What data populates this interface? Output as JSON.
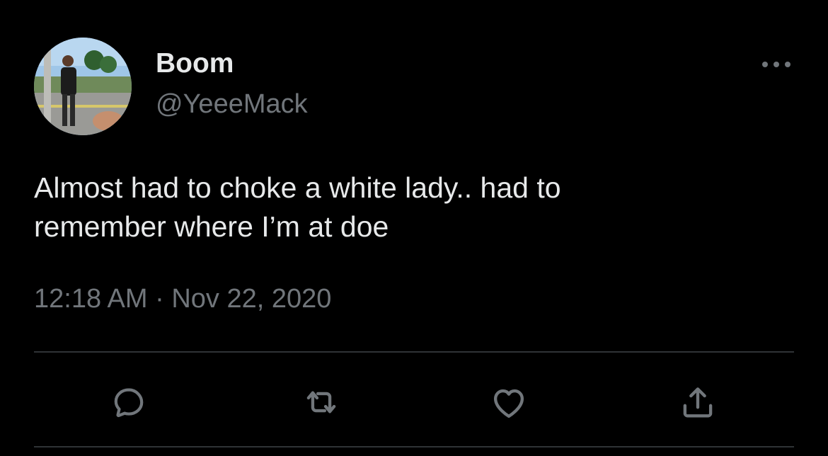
{
  "tweet": {
    "author": {
      "display_name": "Boom",
      "handle": "@YeeeMack"
    },
    "text_lines": [
      "Almost had to choke a white lady.. had to",
      "remember where I’m at doe"
    ],
    "timestamp": "12:18 AM · Nov 22, 2020"
  },
  "actions": [
    {
      "icon": "reply-icon"
    },
    {
      "icon": "retweet-icon"
    },
    {
      "icon": "like-icon"
    },
    {
      "icon": "share-icon"
    }
  ],
  "menu": {
    "icon": "more-options-icon"
  },
  "colors": {
    "background": "#000000",
    "primary_text": "#e7e9ea",
    "secondary_text": "#71767b",
    "divider": "#2f3336"
  }
}
